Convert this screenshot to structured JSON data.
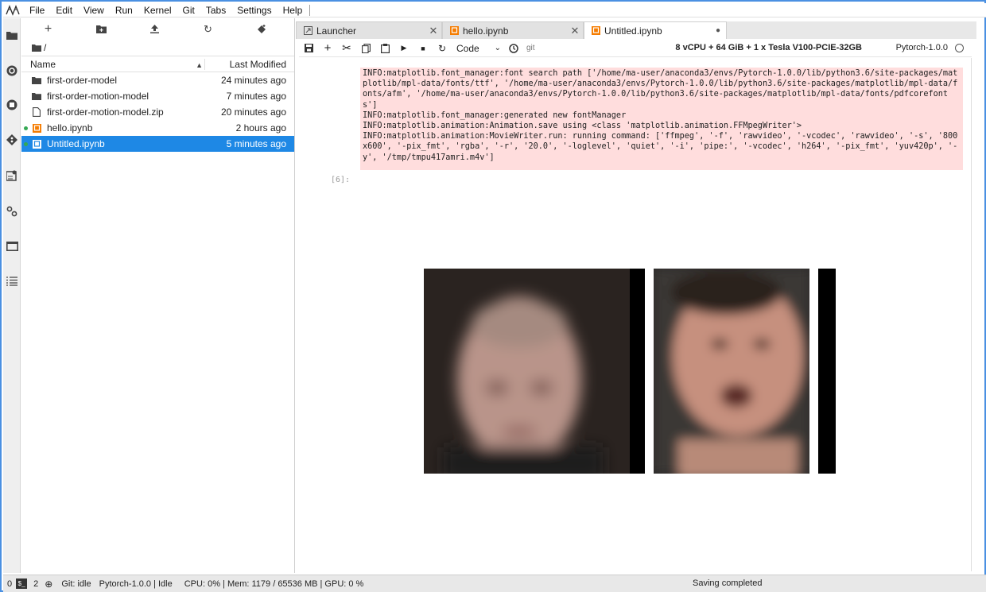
{
  "menubar": {
    "items": [
      "File",
      "Edit",
      "View",
      "Run",
      "Kernel",
      "Git",
      "Tabs",
      "Settings",
      "Help"
    ]
  },
  "activity_bar": {
    "icons": [
      "folder-icon",
      "git-icon",
      "running-icon",
      "diamond-icon",
      "property-inspector-icon",
      "gear-icon",
      "tabs-icon",
      "toc-icon"
    ]
  },
  "filebrowser": {
    "path": "/",
    "columns": {
      "name": "Name",
      "modified": "Last Modified"
    },
    "items": [
      {
        "name": "first-order-model",
        "modified": "24 minutes ago",
        "type": "folder",
        "running": false,
        "selected": false
      },
      {
        "name": "first-order-motion-model",
        "modified": "7 minutes ago",
        "type": "folder",
        "running": false,
        "selected": false
      },
      {
        "name": "first-order-motion-model.zip",
        "modified": "20 minutes ago",
        "type": "file",
        "running": false,
        "selected": false
      },
      {
        "name": "hello.ipynb",
        "modified": "2 hours ago",
        "type": "notebook",
        "running": true,
        "selected": false
      },
      {
        "name": "Untitled.ipynb",
        "modified": "5 minutes ago",
        "type": "notebook",
        "running": true,
        "selected": true
      }
    ]
  },
  "tabs": [
    {
      "label": "Launcher",
      "icon": "launcher-icon",
      "active": false,
      "close": "✕"
    },
    {
      "label": "hello.ipynb",
      "icon": "notebook-icon",
      "active": false,
      "close": "✕"
    },
    {
      "label": "Untitled.ipynb",
      "icon": "notebook-icon",
      "active": true,
      "close": "●"
    }
  ],
  "notebook_toolbar": {
    "cell_type": "Code",
    "git_label": "git",
    "resources": "8 vCPU + 64 GiB + 1 x Tesla V100-PCIE-32GB",
    "kernel": "Pytorch-1.0.0"
  },
  "output": {
    "stderr": "INFO:matplotlib.font_manager:font search path ['/home/ma-user/anaconda3/envs/Pytorch-1.0.0/lib/python3.6/site-packages/matplotlib/mpl-data/fonts/ttf', '/home/ma-user/anaconda3/envs/Pytorch-1.0.0/lib/python3.6/site-packages/matplotlib/mpl-data/fonts/afm', '/home/ma-user/anaconda3/envs/Pytorch-1.0.0/lib/python3.6/site-packages/matplotlib/mpl-data/fonts/pdfcorefonts']\nINFO:matplotlib.font_manager:generated new fontManager\nINFO:matplotlib.animation:Animation.save using <class 'matplotlib.animation.FFMpegWriter'>\nINFO:matplotlib.animation:MovieWriter.run: running command: ['ffmpeg', '-f', 'rawvideo', '-vcodec', 'rawvideo', '-s', '800x600', '-pix_fmt', 'rgba', '-r', '20.0', '-loglevel', 'quiet', '-i', 'pipe:', '-vcodec', 'h264', '-pix_fmt', 'yuv420p', '-y', '/tmp/tmpu417amri.m4v']",
    "prompt": "[6]:"
  },
  "statusbar": {
    "terminals": "0",
    "kernels": "2",
    "git": "Git: idle",
    "kernel_status": "Pytorch-1.0.0 | Idle",
    "resources": "CPU: 0% | Mem: 1179 / 65536 MB | GPU: 0 %",
    "saving": "Saving completed"
  },
  "colors": {
    "accent": "#1e88e5",
    "stderr_bg": "#ffdddd",
    "notebook_orange": "#f57c00",
    "running_green": "#34a853"
  }
}
